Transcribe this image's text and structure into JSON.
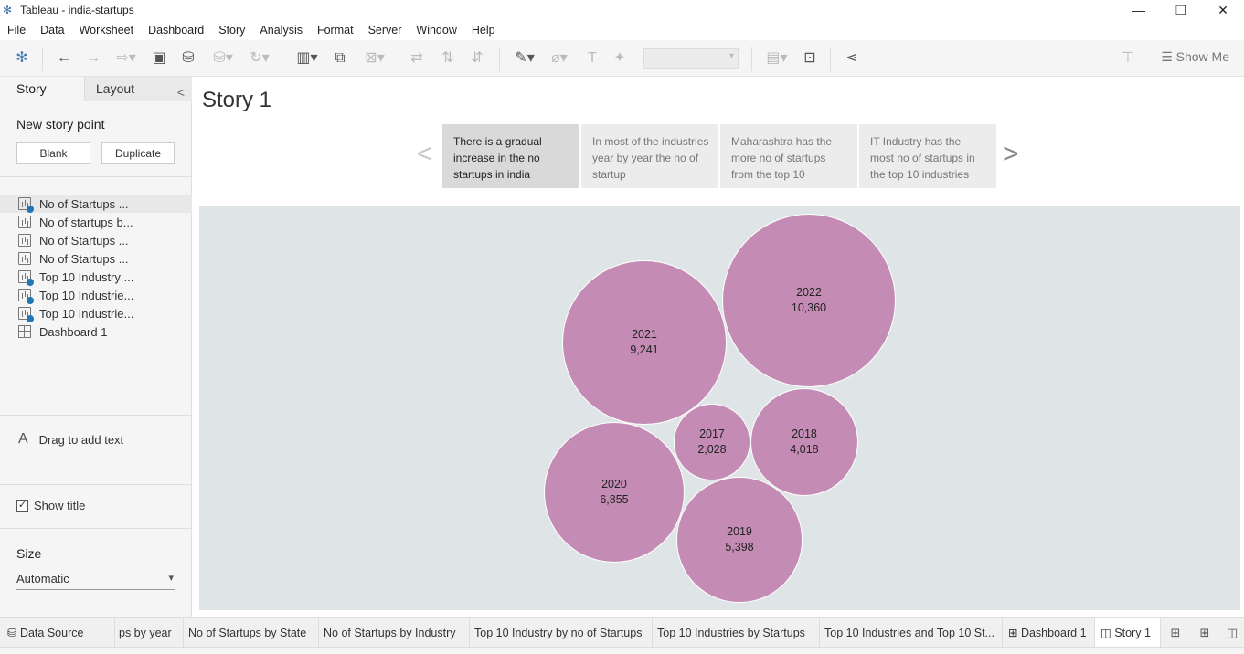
{
  "window": {
    "title": "Tableau - india-startups",
    "controls": [
      "minimize-icon",
      "restore-icon",
      "close-icon"
    ]
  },
  "menu": [
    "File",
    "Data",
    "Worksheet",
    "Dashboard",
    "Story",
    "Analysis",
    "Format",
    "Server",
    "Window",
    "Help"
  ],
  "toolbar": {
    "show_me_label": "Show Me"
  },
  "left_pane": {
    "tabs": [
      "Story",
      "Layout"
    ],
    "new_story_point_label": "New story point",
    "blank_label": "Blank",
    "duplicate_label": "Duplicate",
    "sheets": [
      {
        "label": "No of Startups ...",
        "icon": "worksheet-icon",
        "used": true,
        "selected": true
      },
      {
        "label": "No of startups b...",
        "icon": "worksheet-icon",
        "used": false
      },
      {
        "label": "No of Startups ...",
        "icon": "worksheet-icon",
        "used": false
      },
      {
        "label": "No of Startups ...",
        "icon": "worksheet-icon",
        "used": false
      },
      {
        "label": "Top 10 Industry ...",
        "icon": "worksheet-icon",
        "used": true
      },
      {
        "label": "Top 10 Industrie...",
        "icon": "worksheet-icon",
        "used": true
      },
      {
        "label": "Top 10 Industrie...",
        "icon": "worksheet-icon",
        "used": true
      },
      {
        "label": "Dashboard 1",
        "icon": "dashboard-icon",
        "used": false
      }
    ],
    "drag_text_label": "Drag to add text",
    "show_title_label": "Show title",
    "show_title_checked": true,
    "size_label": "Size",
    "size_value": "Automatic"
  },
  "story": {
    "title": "Story 1",
    "points": [
      {
        "text": "There is a gradual increase in the no startups in india",
        "active": true
      },
      {
        "text": "In most of the industries year by year the no of startup",
        "active": false
      },
      {
        "text": "Maharashtra  has the more no of startups from the top 10",
        "active": false
      },
      {
        "text": "IT Industry has the most no of startups in the top 10 industries",
        "active": false
      }
    ]
  },
  "chart_data": {
    "type": "bubble",
    "title": "",
    "categories": [
      "2017",
      "2018",
      "2019",
      "2020",
      "2021",
      "2022"
    ],
    "values": [
      2028,
      4018,
      5398,
      6855,
      9241,
      10360
    ],
    "labels": [
      "2,028",
      "4,018",
      "5,398",
      "6,855",
      "9,241",
      "10,360"
    ],
    "color": "#c48cb4",
    "background": "#dfe5e6"
  },
  "bottom_tabs": [
    {
      "label": "Data Source",
      "icon": "database-icon"
    },
    {
      "label": "ps by year"
    },
    {
      "label": "No of Startups by State"
    },
    {
      "label": "No of Startups by Industry"
    },
    {
      "label": "Top 10 Industry by no of Startups"
    },
    {
      "label": "Top 10 Industries by Startups"
    },
    {
      "label": "Top 10 Industries and Top 10 St..."
    },
    {
      "label": "Dashboard 1",
      "icon": "dashboard-icon"
    },
    {
      "label": "Story 1",
      "icon": "story-icon",
      "active": true
    }
  ]
}
